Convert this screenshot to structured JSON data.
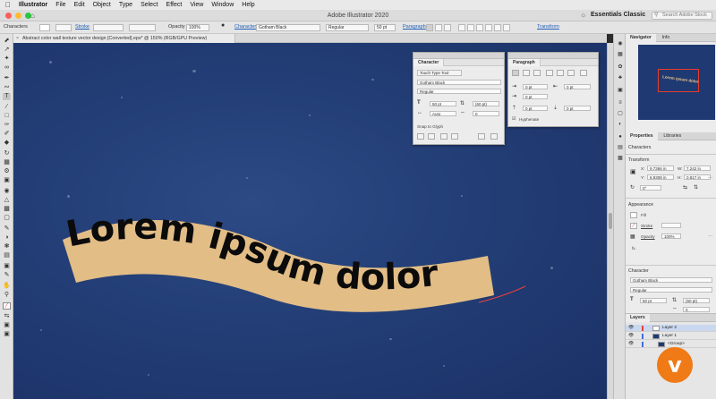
{
  "menubar": {
    "app": "Illustrator",
    "items": [
      "File",
      "Edit",
      "Object",
      "Type",
      "Select",
      "Effect",
      "View",
      "Window",
      "Help"
    ]
  },
  "titlebar": {
    "title": "Adobe Illustrator 2020",
    "workspace": "Essentials Classic",
    "search_placeholder": "Search Adobe Stock"
  },
  "controlbar": {
    "mode": "Characters",
    "stroke_label": "Stroke",
    "opacity_label": "Opacity",
    "opacity_value": "100%",
    "character_label": "Character",
    "font": "Gotham Black",
    "style": "Regular",
    "size": "50 pt",
    "paragraph_label": "Paragraph",
    "transform_label": "Transform"
  },
  "document": {
    "tab_title": "Abstract color wall texture vector design [Converted].eps* @ 150% (RGB/GPU Preview)",
    "close_glyph": "×"
  },
  "canvas": {
    "artwork_text": "Lorem ipsum dolor",
    "banner_color": "#e2bd86",
    "background_color": "#233e76"
  },
  "character_panel": {
    "tab": "Character",
    "touch_type": "Touch Type Tool",
    "font": "Gotham Black",
    "style": "Regular",
    "size": "50 pt",
    "leading": "(60 pt)",
    "kerning": "Auto",
    "tracking": "0",
    "snap_label": "Snap to Glyph"
  },
  "paragraph_panel": {
    "tab": "Paragraph",
    "left_indent": "0 pt",
    "right_indent": "0 pt",
    "first_indent": "0 pt",
    "space_before": "0 pt",
    "space_after": "0 pt",
    "hyphenate": "Hyphenate"
  },
  "right_panel": {
    "nav_tab": "Navigator",
    "info_tab": "Info",
    "nav_text": "Lorem ipsum dolor",
    "props_tab": "Properties",
    "libs_tab": "Libraries",
    "characters_label": "Characters",
    "transform_label": "Transform",
    "x_label": "X:",
    "x_value": "9.7366 in",
    "y_label": "Y:",
    "y_value": "6.9308 in",
    "w_label": "W:",
    "w_value": "7.242 in",
    "h_label": "H:",
    "h_value": "0.817 in",
    "angle_value": "0°",
    "appearance_label": "Appearance",
    "fill_label": "Fill",
    "stroke_label": "Stroke",
    "opacity_label": "Opacity",
    "opacity_value": "100%",
    "fx_label": "fx.",
    "character_label": "Character",
    "font": "Gotham Black",
    "style": "Regular",
    "size": "50 pt",
    "leading": "(60 pt)",
    "tracking": "0"
  },
  "layers": {
    "tab": "Layers",
    "rows": [
      {
        "name": "Layer 2",
        "color": "#e84040"
      },
      {
        "name": "Layer 1",
        "color": "#3f6fe0"
      },
      {
        "name": "<Group>",
        "color": "#3f6fe0"
      }
    ]
  },
  "icons": {
    "apple": "apple-icon",
    "logo": "vimeo-v-logo",
    "logo_glyph": "v"
  }
}
